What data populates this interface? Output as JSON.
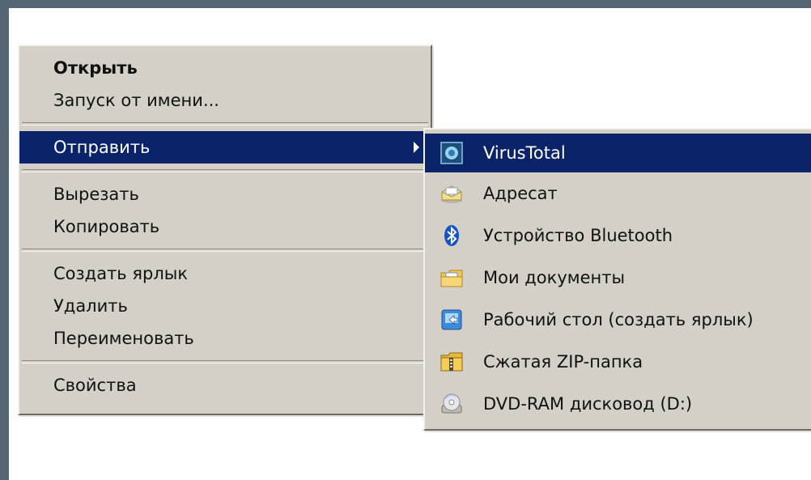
{
  "context_menu": {
    "items": [
      {
        "label": "Открыть"
      },
      {
        "label": "Запуск от имени..."
      },
      {
        "label": "Отправить"
      },
      {
        "label": "Вырезать"
      },
      {
        "label": "Копировать"
      },
      {
        "label": "Создать ярлык"
      },
      {
        "label": "Удалить"
      },
      {
        "label": "Переименовать"
      },
      {
        "label": "Свойства"
      }
    ]
  },
  "submenu": {
    "items": [
      {
        "label": "VirusTotal",
        "icon": "virustotal-icon"
      },
      {
        "label": "Адресат",
        "icon": "mail-recipient-icon"
      },
      {
        "label": "Устройство Bluetooth",
        "icon": "bluetooth-icon"
      },
      {
        "label": "Мои документы",
        "icon": "my-documents-icon"
      },
      {
        "label": "Рабочий стол (создать ярлык)",
        "icon": "desktop-shortcut-icon"
      },
      {
        "label": "Сжатая ZIP-папка",
        "icon": "zip-folder-icon"
      },
      {
        "label": "DVD-RAM дисковод (D:)",
        "icon": "dvd-drive-icon"
      }
    ]
  },
  "colors": {
    "menu_background": "#d4d0c8",
    "highlight": "#0b2469",
    "outer_background": "#566572"
  }
}
